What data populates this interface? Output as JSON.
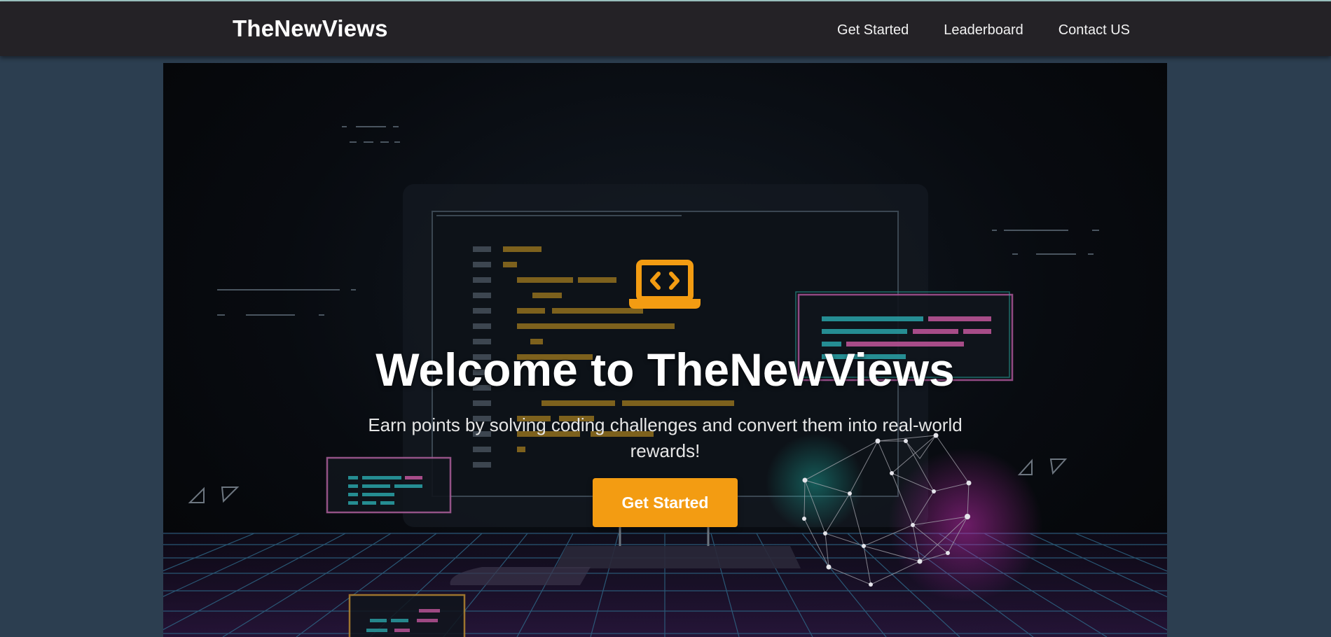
{
  "header": {
    "brand": "TheNewViews",
    "nav": [
      {
        "label": "Get Started"
      },
      {
        "label": "Leaderboard"
      },
      {
        "label": "Contact US"
      }
    ]
  },
  "hero": {
    "icon": "laptop-code-icon",
    "title": "Welcome to TheNewViews",
    "subtitle": "Earn points by solving coding challenges and convert them into real-world rewards!",
    "cta_label": "Get Started"
  },
  "colors": {
    "accent": "#f39c12",
    "navbar": "#242226",
    "page_background": "#2c3e50",
    "hero_background": "#080b10"
  }
}
